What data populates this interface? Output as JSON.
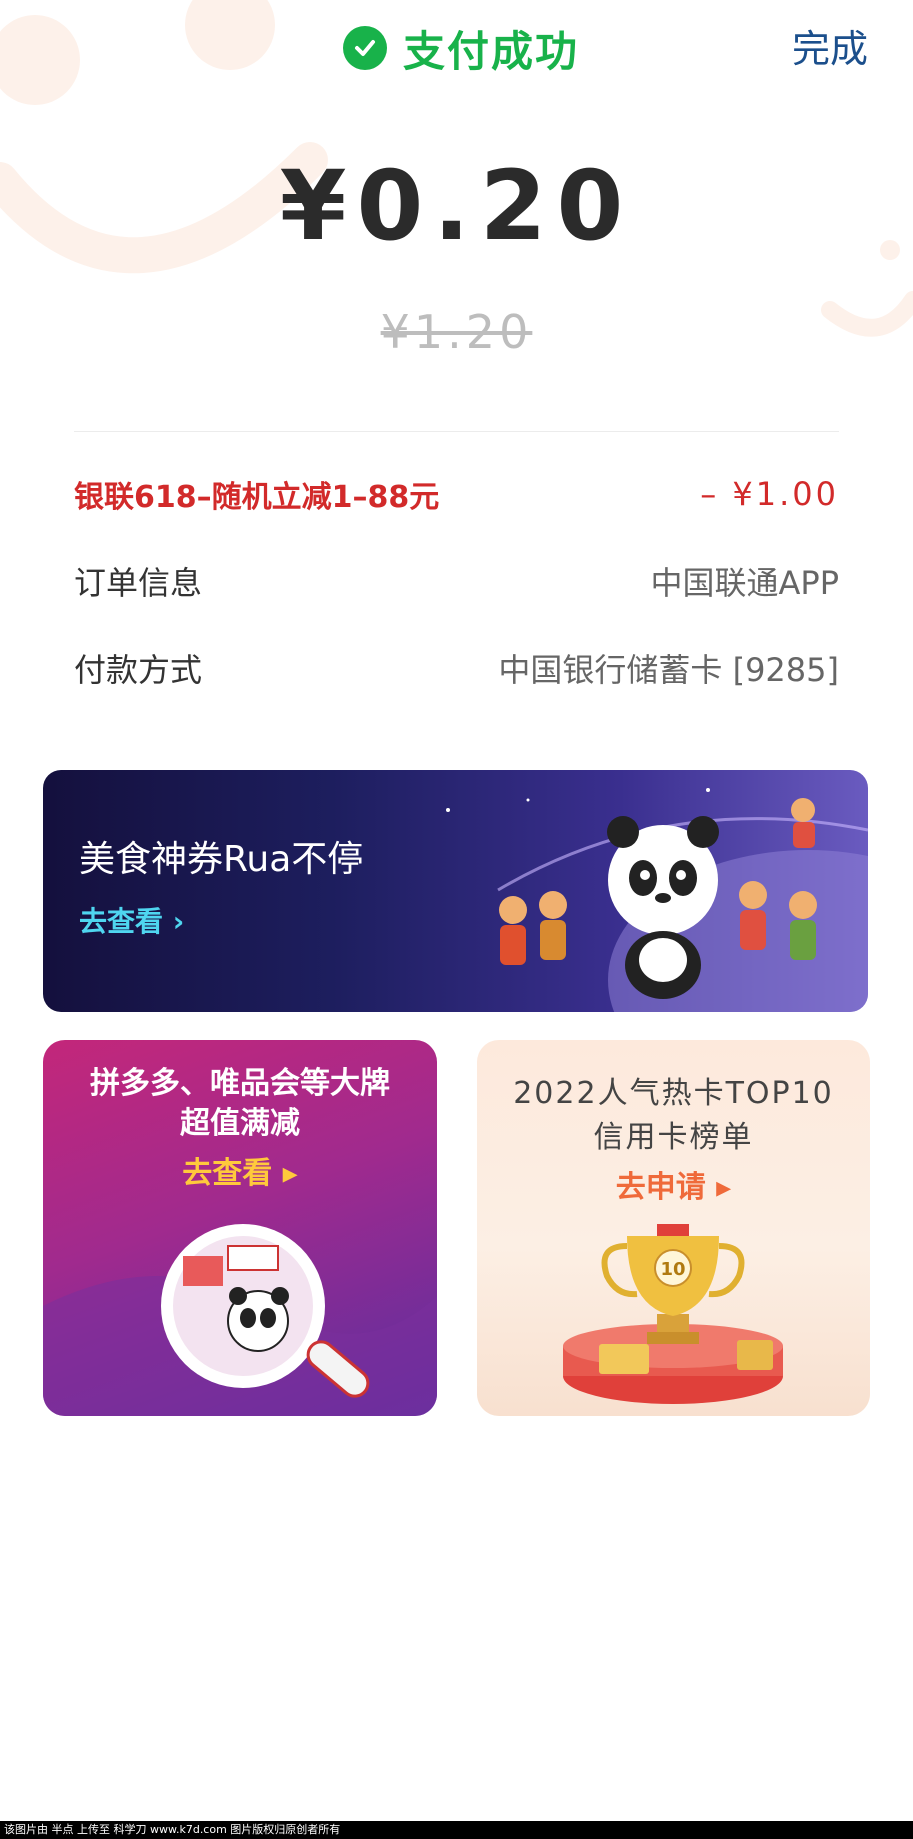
{
  "header": {
    "status_text": "支付成功",
    "done_label": "完成"
  },
  "payment": {
    "amount": "¥0.20",
    "original_amount": "¥1.20"
  },
  "details": {
    "discount": {
      "label": "银联618–随机立减1–88元",
      "value": "– ¥1.00"
    },
    "order": {
      "label": "订单信息",
      "value": "中国联通APP"
    },
    "method": {
      "label": "付款方式",
      "value": "中国银行储蓄卡 [9285]"
    }
  },
  "banner": {
    "title": "美食神券Rua不停",
    "link": "去查看 ›"
  },
  "cards": {
    "left": {
      "line1": "拼多多、唯品会等大牌",
      "line2": "超值满减",
      "cta": "去查看 ▸"
    },
    "right": {
      "line1": "2022人气热卡TOP10",
      "line2": "信用卡榜单",
      "cta": "去申请 ▸"
    }
  },
  "footer": {
    "text": "该图片由 半点 上传至 科学刀 www.k7d.com 图片版权归原创者所有"
  },
  "colors": {
    "success": "#18b24a",
    "done": "#1b4f8c",
    "discount": "#d22a2a",
    "banner_link": "#4fd6f0",
    "left_cta": "#ffc93c",
    "right_cta": "#ef6a3a"
  },
  "icons": [
    "check-icon",
    "chevron-right-icon",
    "panda-mascot",
    "trophy-icon",
    "magnifier-illustration"
  ]
}
